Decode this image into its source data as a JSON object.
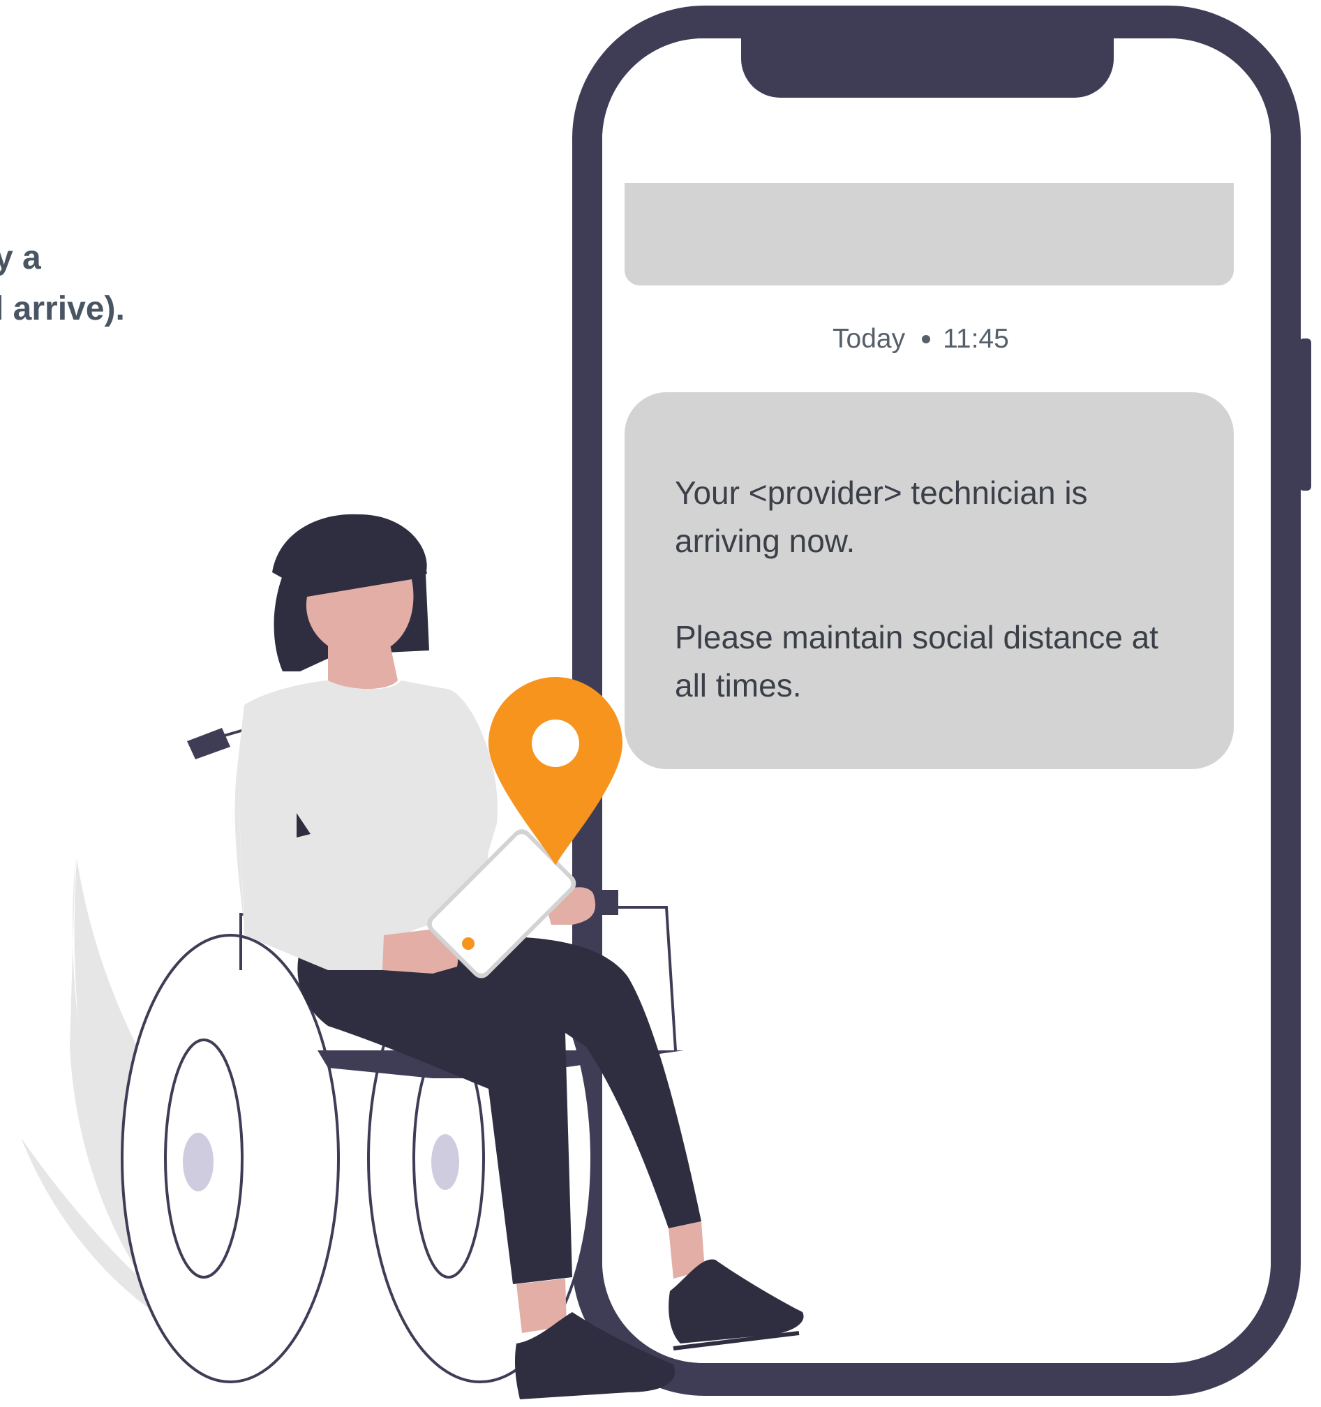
{
  "heading": {
    "line1": "y a",
    "line2": "l arrive)."
  },
  "message": {
    "date_label": "Today",
    "time": "11:45",
    "paragraph1": "Your <provider> technician is arriving now.",
    "paragraph2": "Please maintain social distance at all times."
  },
  "colors": {
    "phone_frame": "#3f3d56",
    "bubble": "#d3d3d3",
    "pin": "#f7941d",
    "skin": "#e2aea6",
    "dark_clothing": "#2f2e41",
    "shirt": "#e6e6e6",
    "wheel_hub": "#cfcce0"
  },
  "icons": {
    "location_pin": "location-pin-icon"
  }
}
